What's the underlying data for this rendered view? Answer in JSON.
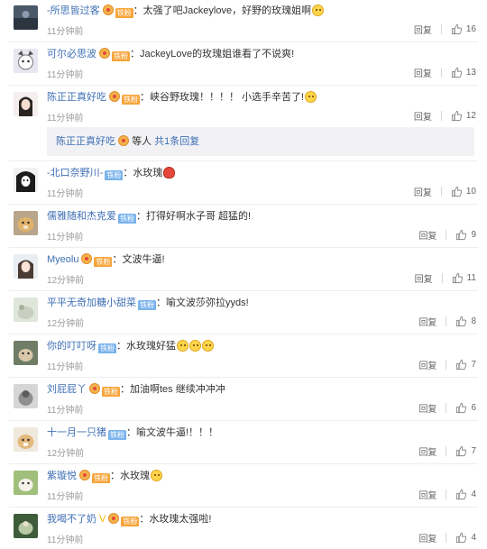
{
  "comments": [
    {
      "name": "-所思皆过客",
      "badge": "铁粉",
      "text": "太强了吧Jackeylove，好野的玫瑰姐啊",
      "time": "11分钟前",
      "reply": "回复",
      "likes": "16"
    },
    {
      "name": "可尔必思波",
      "badge": "铁粉",
      "text": "JackeyLove的玫瑰姐谁看了不说爽!",
      "time": "11分钟前",
      "reply": "回复",
      "likes": "13"
    },
    {
      "name": "陈正正真好吃",
      "badge": "铁粉",
      "text": "峡谷野玫瑰！！！！ 小选手辛苦了!",
      "time": "11分钟前",
      "reply": "回复",
      "likes": "12"
    },
    {
      "name": "-北口奈野川-",
      "badge": "铁粉",
      "text": "水玫瑰",
      "time": "11分钟前",
      "reply": "回复",
      "likes": "10"
    },
    {
      "name": "儒雅随和杰克爱",
      "badge": "铁粉",
      "text": "打得好啊水子哥 超猛的!",
      "time": "11分钟前",
      "reply": "回复",
      "likes": "9"
    },
    {
      "name": "Myeolu",
      "badge": "铁粉",
      "text": "文波牛逼!",
      "time": "12分钟前",
      "reply": "回复",
      "likes": "11"
    },
    {
      "name": "平平无奇加糖小甜菜",
      "badge": "铁粉",
      "text": "喻文波莎弥拉yyds!",
      "time": "12分钟前",
      "reply": "回复",
      "likes": "8"
    },
    {
      "name": "你的叮叮呀",
      "badge": "铁粉",
      "text": "水玫瑰好猛",
      "time": "11分钟前",
      "reply": "回复",
      "likes": "7"
    },
    {
      "name": "刘屁屁丫",
      "badge": "铁粉",
      "text": "加油啊tes 继续冲冲冲",
      "time": "11分钟前",
      "reply": "回复",
      "likes": "6"
    },
    {
      "name": "十一月一只猪",
      "badge": "铁粉",
      "text": "喻文波牛逼!！！！",
      "time": "12分钟前",
      "reply": "回复",
      "likes": "7"
    },
    {
      "name": "紫璇悦",
      "badge": "铁粉",
      "text": "水玫瑰",
      "time": "11分钟前",
      "reply": "回复",
      "likes": "4"
    },
    {
      "name": "我喝不了奶",
      "badge": "铁粉",
      "text": "水玫瑰太强啦!",
      "time": "11分钟前",
      "reply": "回复",
      "likes": "4"
    }
  ],
  "reply_summary": {
    "name": "陈正正真好吃",
    "others": "等人",
    "link": "共1条回复"
  },
  "colors": {
    "accent": "#3f6fb4",
    "name_orange": "#eb7350",
    "badge_gold": "#f7a53b",
    "badge_blue": "#7ab3ec"
  }
}
